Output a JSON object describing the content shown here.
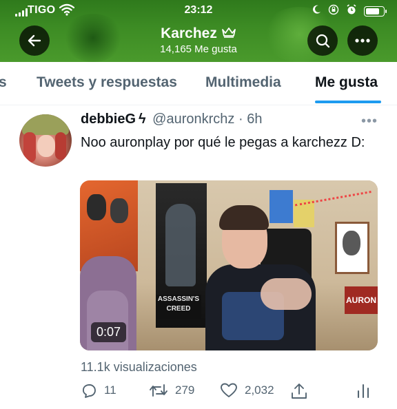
{
  "status_bar": {
    "carrier": "TIGO",
    "time": "23:12",
    "battery_level": 0.85
  },
  "header": {
    "profile_name": "Karchez",
    "likes_count": "14,165 Me gusta",
    "back_icon": "arrow-left-icon",
    "search_icon": "search-icon",
    "more_icon": "more-horizontal-icon"
  },
  "tabs": [
    {
      "label": "s",
      "active": false
    },
    {
      "label": "Tweets y respuestas",
      "active": false
    },
    {
      "label": "Multimedia",
      "active": false
    },
    {
      "label": "Me gusta",
      "active": true
    }
  ],
  "tweet": {
    "display_name": "debbieG",
    "badge": "ϟ",
    "handle": "@auronkrchz",
    "separator": "·",
    "age": "6h",
    "text": "Noo auronplay por qué le pegas a karchezz D:",
    "video_duration": "0:07",
    "views": "11.1k visualizaciones",
    "actions": {
      "replies": "11",
      "retweets": "279",
      "likes": "2,032"
    }
  },
  "colors": {
    "accent": "#1d9bf0",
    "header_green": "#3d8c24",
    "text_primary": "#0f1419",
    "text_secondary": "#536471"
  }
}
